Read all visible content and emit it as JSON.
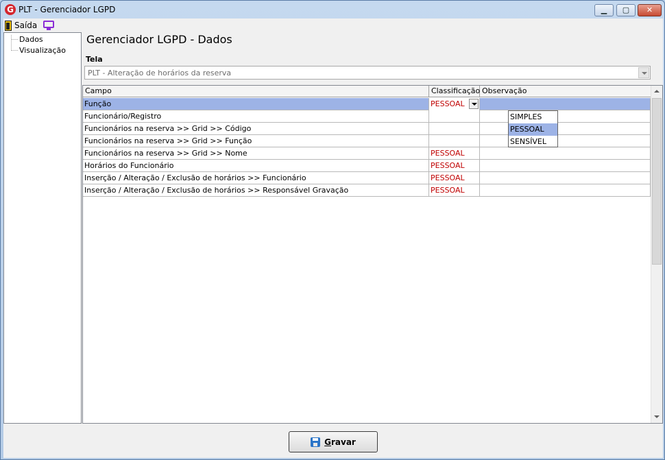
{
  "window": {
    "title": "PLT - Gerenciador LGPD",
    "logo_letter": "G",
    "min_glyph": "▁",
    "max_glyph": "▢",
    "close_glyph": "✕"
  },
  "menu": {
    "exit_label": "Saída"
  },
  "tree": {
    "items": [
      "Dados",
      "Visualização"
    ]
  },
  "page": {
    "title": "Gerenciador LGPD - Dados",
    "tela_label": "Tela",
    "tela_value": "PLT - Alteração de horários da reserva"
  },
  "grid": {
    "columns": [
      "Campo",
      "Classificação",
      "Observação"
    ],
    "rows": [
      {
        "campo": "Função",
        "classificacao": "PESSOAL",
        "observacao": ""
      },
      {
        "campo": "Funcionário/Registro",
        "classificacao": "",
        "observacao": ""
      },
      {
        "campo": "Funcionários na reserva >> Grid >> Código",
        "classificacao": "",
        "observacao": ""
      },
      {
        "campo": "Funcionários na reserva >> Grid >> Função",
        "classificacao": "",
        "observacao": ""
      },
      {
        "campo": "Funcionários na reserva >> Grid >> Nome",
        "classificacao": "PESSOAL",
        "observacao": ""
      },
      {
        "campo": "Horários do Funcionário",
        "classificacao": "PESSOAL",
        "observacao": ""
      },
      {
        "campo": "Inserção / Alteração / Exclusão de horários >> Funcionário",
        "classificacao": "PESSOAL",
        "observacao": ""
      },
      {
        "campo": "Inserção / Alteração / Exclusão de horários >> Responsável Gravação",
        "classificacao": "PESSOAL",
        "observacao": ""
      }
    ],
    "dropdown_options": [
      "SIMPLES",
      "PESSOAL",
      "SENSÍVEL"
    ]
  },
  "footer": {
    "save_label": "Gravar"
  },
  "colors": {
    "selection": "#9db3e6",
    "classification_text": "#c00000",
    "save_icon": "#2a74c8"
  },
  "icons": {
    "exit": "door-icon",
    "monitor": "monitor-icon",
    "save": "floppy-disk-icon"
  }
}
